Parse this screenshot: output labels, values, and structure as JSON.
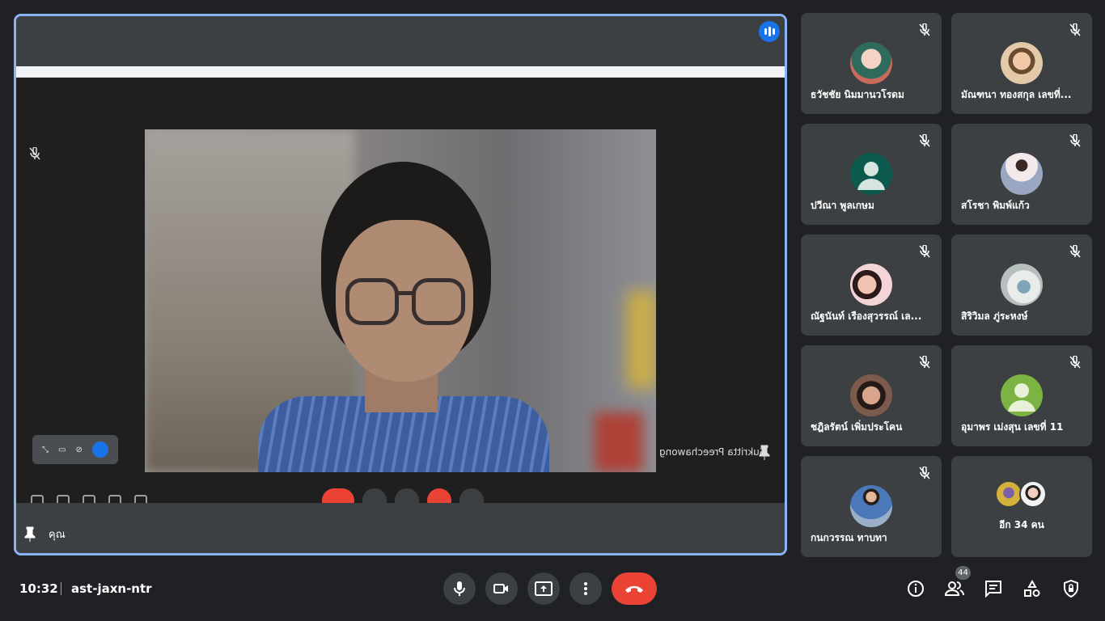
{
  "stage": {
    "presenter_mirror_name": "Sukritta Preechawong",
    "self_label": "คุณ"
  },
  "participants": [
    {
      "name": "ธวัชชัย นิมมานวโรดม",
      "avatar_type": "photo",
      "color": "#c96b5a"
    },
    {
      "name": "มัณฑนา ทองสกุล เลขที่...",
      "avatar_type": "photo",
      "color": "#d9a07e"
    },
    {
      "name": "ปวีณา พูลเกษม",
      "avatar_type": "default",
      "color": "#0b5a4d"
    },
    {
      "name": "สโรชา พิมพ์แก้ว",
      "avatar_type": "photo",
      "color": "#e8e4e6"
    },
    {
      "name": "ณัฐนันท์ เรืองสุวรรณ์ เล...",
      "avatar_type": "photo",
      "color": "#e9b1b5"
    },
    {
      "name": "สิริวิมล ภู่ระหงษ์",
      "avatar_type": "photo",
      "color": "#cfd6d4"
    },
    {
      "name": "ชฎิลรัตน์ เพิ่มประโคน",
      "avatar_type": "photo",
      "color": "#a06e5c"
    },
    {
      "name": "อุมาพร เม่งสุน เลขที่ 11",
      "avatar_type": "default",
      "color": "#7cb342"
    },
    {
      "name": "กนกวรรณ ทาบทา",
      "avatar_type": "photo",
      "color": "#4a78b8"
    }
  ],
  "more_tile": {
    "label": "อีก 34 คน"
  },
  "bottom": {
    "time": "10:32",
    "meeting_code": "ast-jaxn-ntr",
    "people_count": "44"
  },
  "colors": {
    "background": "#202124",
    "tile": "#3c4043",
    "accent_blue": "#1a73e8",
    "active_border": "#8ab4f8",
    "end_call": "#ea4335"
  },
  "icons": {
    "controls": [
      "mic-icon",
      "camera-icon",
      "present-screen-icon",
      "more-vert-icon",
      "end-call-icon"
    ],
    "right": [
      "info-icon",
      "people-icon",
      "chat-icon",
      "activities-icon",
      "host-controls-icon"
    ]
  }
}
